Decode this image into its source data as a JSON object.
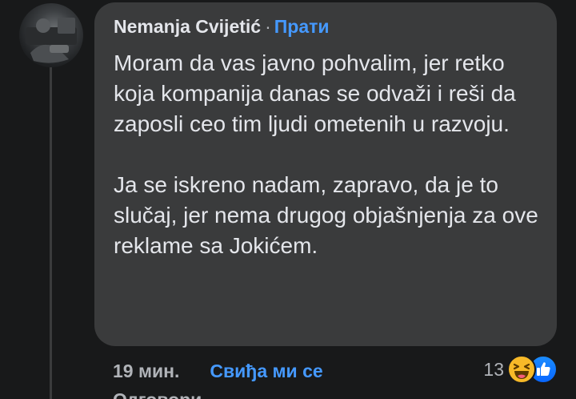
{
  "comment": {
    "author": "Nemanja Cvijetić",
    "separator": "·",
    "follow_label": "Прати",
    "paragraphs": [
      "Moram da vas javno pohvalim, jer retko koja kompanija danas se odvaži i reši da zaposli ceo tim ljudi ometenih u razvoju.",
      "Ja se iskreno nadam, zapravo, da je to slučaj, jer nema drugog objašnjenja za ove reklame sa Jokićem."
    ]
  },
  "actions": {
    "time": "19 мин.",
    "like_label": "Свиђа ми се",
    "reply_label": "Одговори"
  },
  "reactions": {
    "count": "13",
    "types": [
      "haha-icon",
      "like-icon"
    ]
  },
  "colors": {
    "background": "#18191a",
    "bubble": "#3a3b3c",
    "link": "#4599ff",
    "secondary_text": "#b0b3b8"
  }
}
